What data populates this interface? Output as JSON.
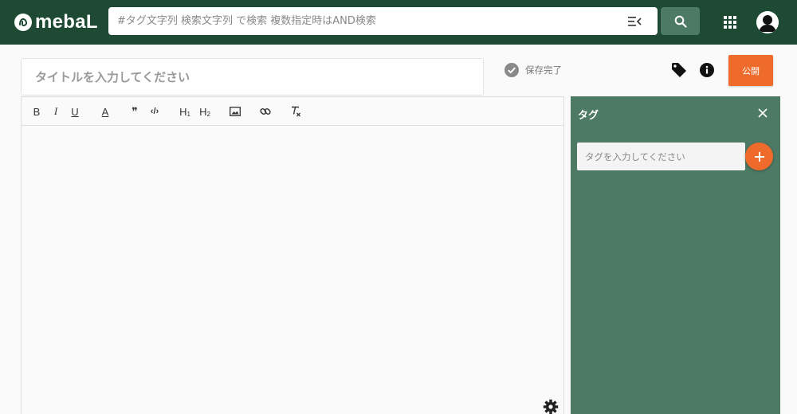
{
  "header": {
    "logo_text": "mebaL",
    "logo_icon": "mebal-logo-icon",
    "search_placeholder": "#タグ文字列 検索文字列 で検索 複数指定時はAND検索",
    "search_value": "",
    "filter_icon": "filter-list-icon",
    "search_icon": "magnifier-icon",
    "apps_icon": "grid-apps-icon",
    "avatar_icon": "user-avatar-icon"
  },
  "title": {
    "placeholder": "タイトルを入力してください",
    "value": ""
  },
  "save_status": {
    "icon": "check-circle-icon",
    "text": "保存完了"
  },
  "actions": {
    "tag_icon": "tag-icon",
    "info_icon": "info-icon",
    "publish_label": "公開"
  },
  "toolbar": {
    "bold": "B",
    "italic": "I",
    "underline": "U",
    "color": "A",
    "quote": "❞",
    "code": "‹/›",
    "h1": "H",
    "h1_sub": "1",
    "h2": "H",
    "h2_sub": "2",
    "image_icon": "image-icon",
    "link_icon": "link-icon",
    "clear_format_icon": "clear-format-icon"
  },
  "editor": {
    "content": "",
    "settings_icon": "gear-icon"
  },
  "tag_panel": {
    "title": "タグ",
    "close_icon": "close-icon",
    "input_placeholder": "タグを入力してください",
    "input_value": "",
    "add_icon": "plus-icon"
  },
  "colors": {
    "header_bg": "#1e4a33",
    "accent_green": "#4d7a65",
    "accent_orange": "#ee6b2b",
    "page_bg": "#fafafa"
  }
}
